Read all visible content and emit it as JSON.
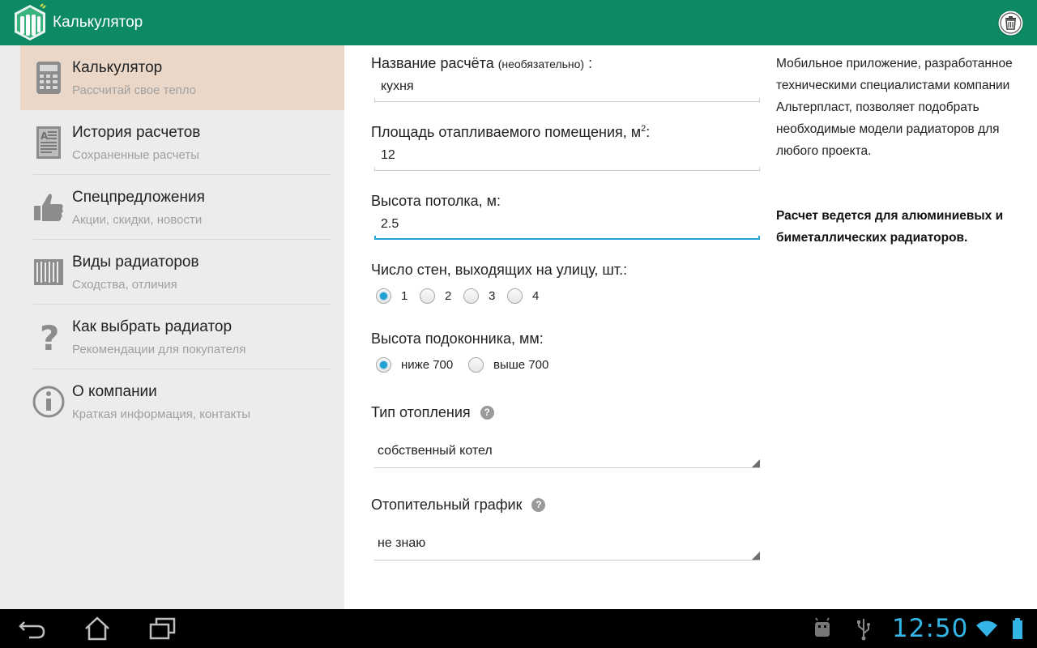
{
  "app": {
    "title": "Калькулятор",
    "accent_color": "#0c8a63"
  },
  "sidebar": {
    "items": [
      {
        "title": "Калькулятор",
        "subtitle": "Рассчитай свое тепло",
        "icon": "calculator-icon",
        "active": true
      },
      {
        "title": "История расчетов",
        "subtitle": "Сохраненные расчеты",
        "icon": "document-icon",
        "active": false
      },
      {
        "title": "Спецпредложения",
        "subtitle": "Акции, скидки, новости",
        "icon": "thumbs-up-icon",
        "active": false
      },
      {
        "title": "Виды радиаторов",
        "subtitle": "Сходства, отличия",
        "icon": "radiator-icon",
        "active": false
      },
      {
        "title": "Как выбрать радиатор",
        "subtitle": "Рекомендации для покупателя",
        "icon": "question-icon",
        "active": false
      },
      {
        "title": "О компании",
        "subtitle": "Краткая информация, контакты",
        "icon": "info-icon",
        "active": false
      }
    ]
  },
  "form": {
    "name": {
      "label": "Название расчёта",
      "hint": "(необязательно)",
      "colon": ":",
      "value": "кухня"
    },
    "area": {
      "label": "Площадь отапливаемого помещения, м",
      "sup": "2",
      "colon": ":",
      "value": "12"
    },
    "ceiling": {
      "label": "Высота потолка, м:",
      "value": "2.5"
    },
    "walls": {
      "label": "Число стен, выходящих на улицу, шт.:",
      "options": [
        "1",
        "2",
        "3",
        "4"
      ],
      "selected": "1"
    },
    "sill": {
      "label": "Высота подоконника, мм:",
      "options": [
        "ниже 700",
        "выше 700"
      ],
      "selected": "ниже 700"
    },
    "heating_type": {
      "label": "Тип отопления",
      "value": "собственный котел"
    },
    "heating_schedule": {
      "label": "Отопительный график",
      "value": "не знаю"
    }
  },
  "info": {
    "description": "Мобильное приложение, разработанное техническими специалистами компании Альтерпласт, позволяет подобрать необходимые модели радиаторов для любого проекта.",
    "note": "Расчет ведется для алюминиевых и биметаллических радиаторов."
  },
  "status_bar": {
    "time": "12:50",
    "accent_color": "#33b5e5"
  }
}
